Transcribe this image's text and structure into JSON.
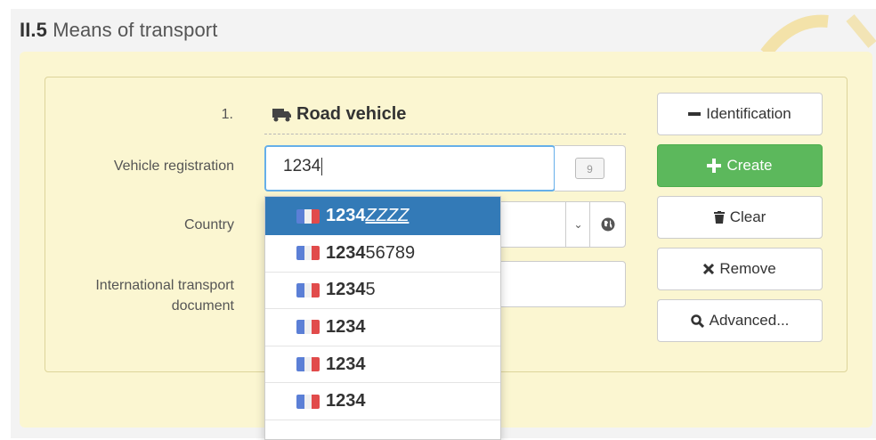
{
  "section": {
    "number": "II.5",
    "title": "Means of transport"
  },
  "form": {
    "index": "1.",
    "transport_mode": "Road vehicle",
    "labels": {
      "vehicle_registration": "Vehicle registration",
      "country": "Country",
      "intl_doc_line1": "International transport",
      "intl_doc_line2": "document"
    },
    "vehicle_registration_value": "1234",
    "char_count": "9"
  },
  "buttons": {
    "identification": "Identification",
    "create": "Create",
    "clear": "Clear",
    "remove": "Remove",
    "advanced": "Advanced..."
  },
  "autocomplete": {
    "options": [
      {
        "match": "1234",
        "rest": "ZZZZ",
        "flag": "france-flag",
        "active": true
      },
      {
        "match": "1234",
        "rest": "56789",
        "flag": "france-flag",
        "active": false
      },
      {
        "match": "1234",
        "rest": "5",
        "flag": "france-flag",
        "active": false
      },
      {
        "match": "1234",
        "rest": "",
        "flag": "france-flag",
        "active": false
      },
      {
        "match": "1234",
        "rest": "",
        "flag": "france-flag",
        "active": false
      },
      {
        "match": "1234",
        "rest": "",
        "flag": "france-flag",
        "active": false
      }
    ]
  },
  "colors": {
    "panel_bg": "#fbf6d1",
    "create_green": "#5cb85c",
    "active_blue": "#337ab7",
    "focus_border": "#66afe9"
  }
}
